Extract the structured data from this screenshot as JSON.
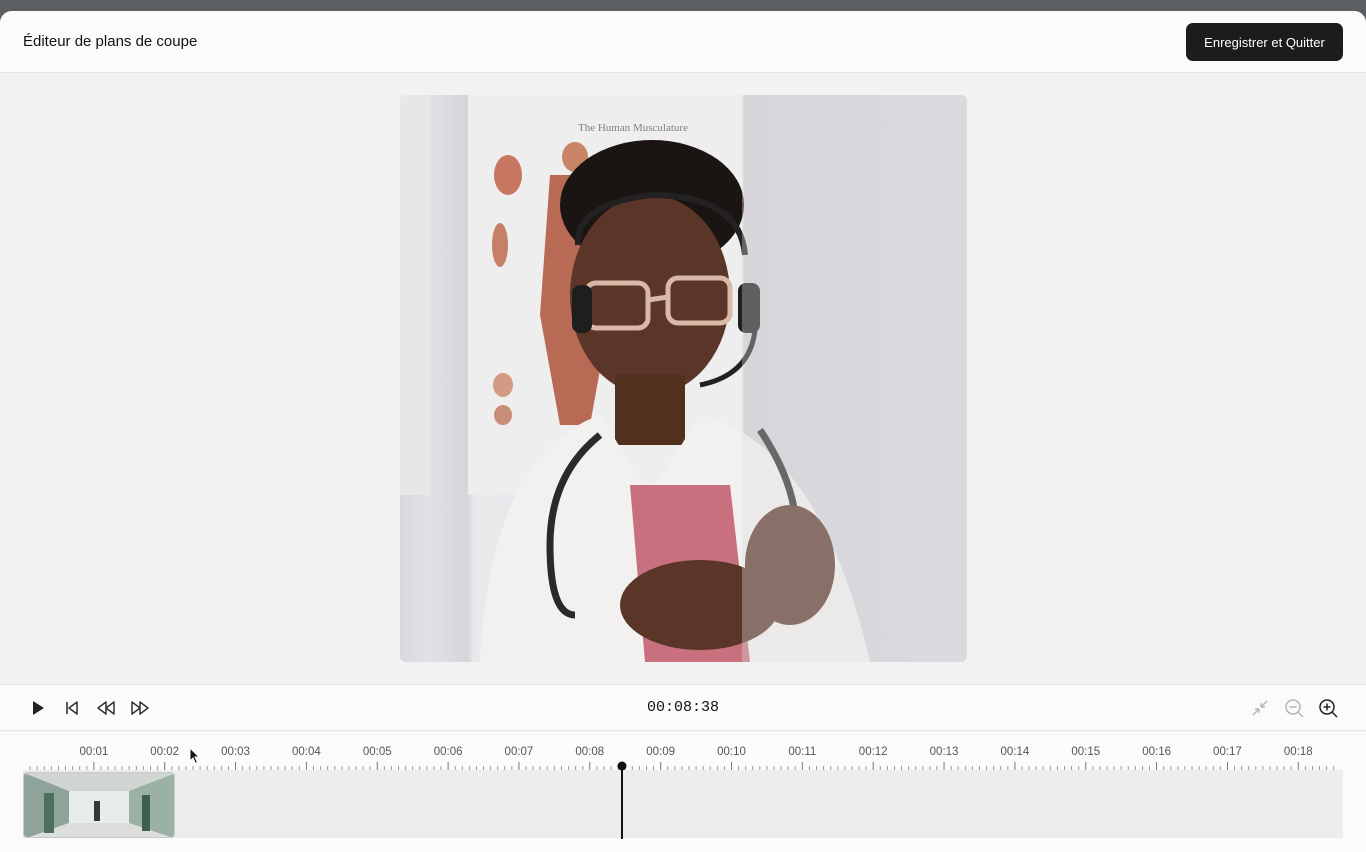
{
  "header": {
    "title": "Éditeur de plans de coupe",
    "save_label": "Enregistrer et Quitter"
  },
  "preview": {
    "poster_text": "The Human Musculature"
  },
  "controls": {
    "timecode": "00:08:38",
    "icons": [
      "play-icon",
      "skip-to-start-icon",
      "rewind-icon",
      "fast-forward-icon",
      "fit-to-screen-icon",
      "zoom-out-icon",
      "zoom-in-icon"
    ]
  },
  "timeline": {
    "labels": [
      "00:01",
      "00:02",
      "00:03",
      "00:04",
      "00:05",
      "00:06",
      "00:07",
      "00:08",
      "00:09",
      "00:10",
      "00:11",
      "00:12",
      "00:13",
      "00:14",
      "00:15",
      "00:16",
      "00:17",
      "00:18"
    ],
    "playhead_seconds": 8.38
  },
  "colors": {
    "accent": "#1c1c1e",
    "background": "#f2f2f2",
    "topbar": "#5c5f62"
  }
}
